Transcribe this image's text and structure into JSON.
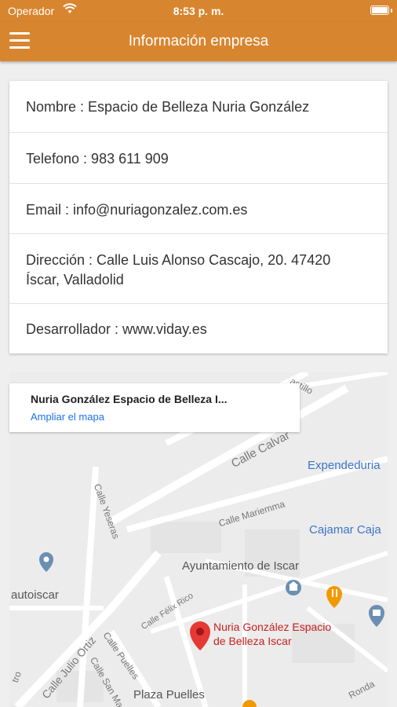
{
  "status": {
    "carrier": "Operador",
    "time": "8:53 p. m."
  },
  "appbar": {
    "title": "Información empresa"
  },
  "info": [
    {
      "text": "Nombre : Espacio de Belleza Nuria González"
    },
    {
      "text": "Telefono : 983 611 909"
    },
    {
      "text": "Email : info@nuriagonzalez.com.es"
    },
    {
      "text": "Dirección : Calle Luis Alonso Cascajo, 20. 47420",
      "text2": "Íscar, Valladolid"
    },
    {
      "text": "Desarrollador : www.viday.es"
    }
  ],
  "map": {
    "place_name": "Nuria González Espacio de Belleza I...",
    "enlarge": "Ampliar el mapa",
    "labels": {
      "expendeduria": "Expendeduria",
      "cajamar": "Cajamar Caja",
      "ayuntamiento": "Ayuntamiento de Iscar",
      "autoiscar": "autoiscar",
      "marker_line1": "Nuria González Espacio",
      "marker_line2": "de Belleza Iscar",
      "plaza": "Plaza Puelles",
      "calle_calvario": "Calle Calvar",
      "calle_mariemma": "Calle Mariemma",
      "calle_yeseras": "Calle Yeseras",
      "calle_felix": "Calle Félix Rico",
      "calle_julio": "Calle Julio Ortiz",
      "calle_puelles": "Calle Puelles",
      "calle_san": "Calle San Ma",
      "castillo": "astillo",
      "ronda": "Ronda",
      "tro": "tro"
    },
    "colors": {
      "marker": "#e53935",
      "poi_blue": "#6b8fb3",
      "poi_orange": "#f29900"
    }
  }
}
